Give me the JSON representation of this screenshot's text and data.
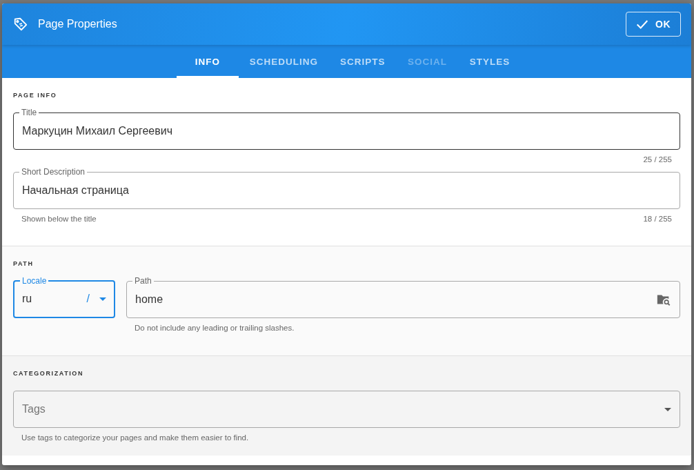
{
  "dialog": {
    "title": "Page Properties",
    "ok_button": "OK"
  },
  "tabs": [
    {
      "label": "INFO",
      "selected": true,
      "disabled": false
    },
    {
      "label": "SCHEDULING",
      "selected": false,
      "disabled": false
    },
    {
      "label": "SCRIPTS",
      "selected": false,
      "disabled": false
    },
    {
      "label": "SOCIAL",
      "selected": false,
      "disabled": true
    },
    {
      "label": "STYLES",
      "selected": false,
      "disabled": false
    }
  ],
  "sections": [
    {
      "heading": "PAGE INFO",
      "rows": [
        {
          "fields": [
            {
              "kind": "text",
              "label": "Title",
              "value": "Маркуцин Михаил Сергеевич",
              "hovered": true,
              "focused": false,
              "counter": "25 / 255"
            }
          ]
        },
        {
          "fields": [
            {
              "kind": "text",
              "label": "Short Description",
              "value": "Начальная страница",
              "hovered": false,
              "focused": false,
              "hint": "Shown below the title",
              "counter": "18 / 255"
            }
          ]
        }
      ]
    },
    {
      "heading": "PATH",
      "rows": [
        {
          "fields": [
            {
              "kind": "select",
              "label": "Locale",
              "value": "ru",
              "suffix": "/",
              "hovered": false,
              "focused": true
            },
            {
              "kind": "browse",
              "label": "Path",
              "value": "home",
              "hovered": false,
              "focused": false,
              "hint": "Do not include any leading or trailing slashes."
            }
          ]
        }
      ]
    },
    {
      "heading": "CATEGORIZATION",
      "rows": [
        {
          "fields": [
            {
              "kind": "select",
              "placeholder": "Tags",
              "hovered": false,
              "focused": false,
              "hint": "Use tags to categorize your pages and make them easier to find."
            }
          ]
        }
      ]
    }
  ]
}
